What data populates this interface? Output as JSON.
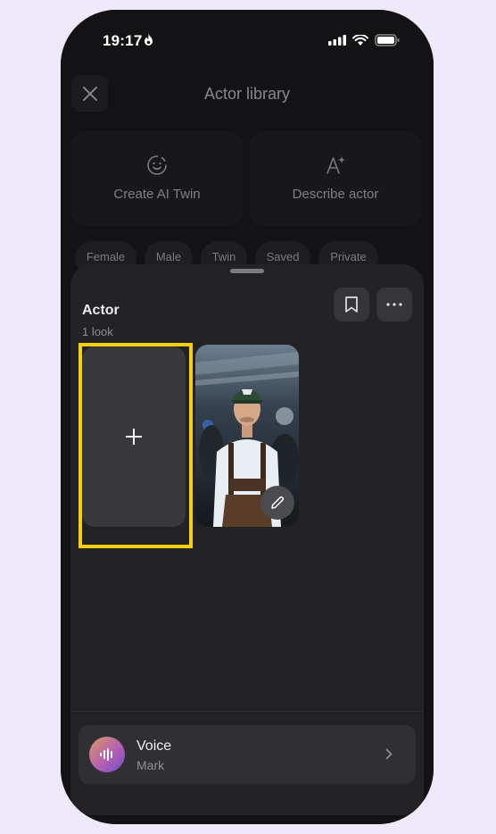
{
  "status_bar": {
    "time": "19:17"
  },
  "header": {
    "title": "Actor library"
  },
  "actions": [
    {
      "label": "Create AI Twin",
      "icon": "smiley-sparkle-icon"
    },
    {
      "label": "Describe actor",
      "icon": "text-sparkle-icon"
    }
  ],
  "filters": [
    "Female",
    "Male",
    "Twin",
    "Saved",
    "Private"
  ],
  "sheet": {
    "title": "Actor",
    "subtitle": "1 look",
    "add_label": "+",
    "voice": {
      "title": "Voice",
      "name": "Mark"
    }
  },
  "colors": {
    "highlight": "#f4d011",
    "sheet_bg": "#232326",
    "voice_gradient": [
      "#d89b5e",
      "#b55fb3",
      "#6f4fc7"
    ]
  }
}
